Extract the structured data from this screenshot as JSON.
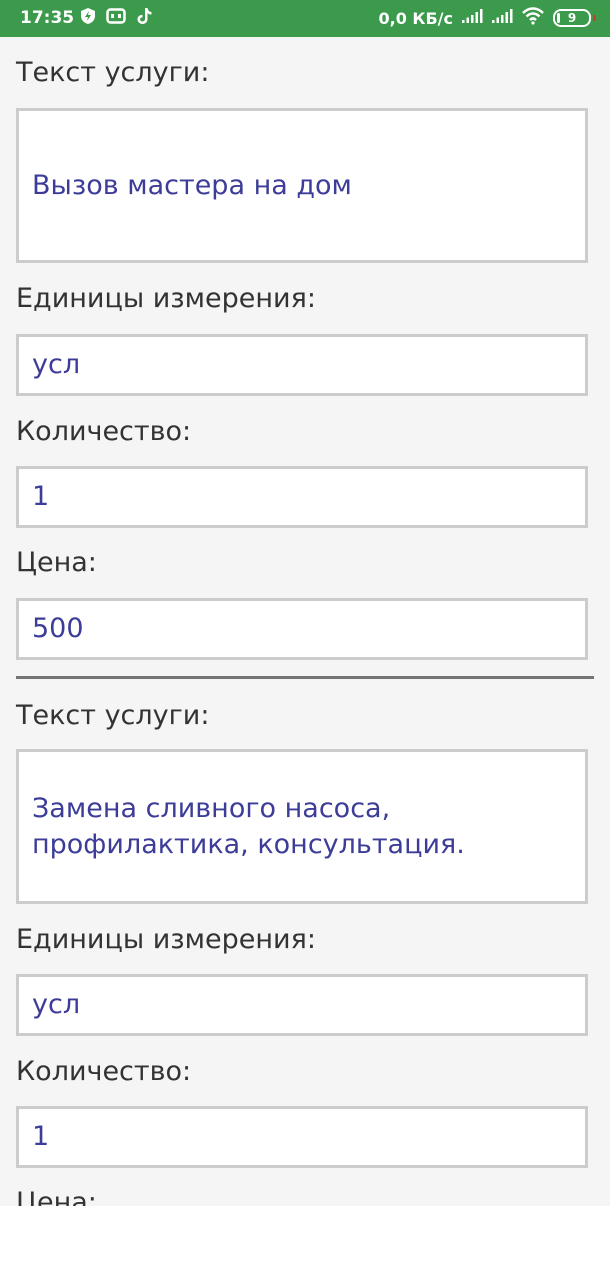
{
  "status_bar": {
    "time": "17:35",
    "network_speed": "0,0 КБ/с",
    "battery_level": "9",
    "battery_fraction": 0.09,
    "icons": [
      "shield-icon",
      "gamepad-icon",
      "tiktok-icon",
      "signal-icon",
      "signal-icon",
      "wifi-icon",
      "battery-icon"
    ]
  },
  "services": [
    {
      "text_label": "Текст услуги:",
      "text_value": "Вызов мастера на дом",
      "unit_label": "Единицы измерения:",
      "unit_value": "усл",
      "qty_label": "Количество:",
      "qty_value": "1",
      "price_label": "Цена:",
      "price_value": "500"
    },
    {
      "text_label": "Текст услуги:",
      "text_value": "Замена сливного насоса,\nпрофилактика, консультация.",
      "unit_label": "Единицы измерения:",
      "unit_value": "усл",
      "qty_label": "Количество:",
      "qty_value": "1",
      "price_label": "Цена:"
    }
  ]
}
